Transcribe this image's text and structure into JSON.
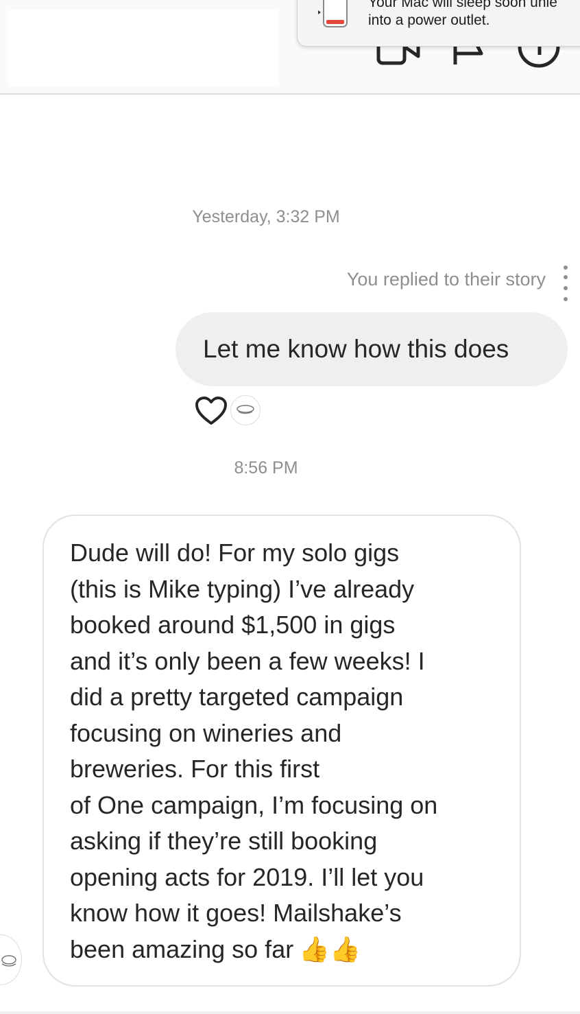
{
  "notification": {
    "line1": "Your Mac will sleep soon unle",
    "line2": "into a power outlet.",
    "icon": "battery-low-icon"
  },
  "header": {
    "icons": [
      "video-call-icon",
      "flag-icon",
      "info-icon"
    ]
  },
  "thread": {
    "timestamp_1": "Yesterday, 3:32 PM",
    "story_reply_label": "You replied to their story",
    "outgoing_message": "Let me know how this does",
    "timestamp_2": "8:56 PM",
    "incoming_lines": [
      "Dude will do! For my solo gigs",
      "(this is Mike typing) I’ve already",
      "booked around $1,500 in gigs",
      "and it’s only been a few weeks! I",
      "did a pretty targeted campaign",
      "focusing on wineries and",
      "breweries. For this first",
      "of One campaign, I’m focusing on",
      "asking if they’re still booking",
      "opening acts for 2019. I’ll let you",
      "know how it goes! Mailshake’s",
      "been amazing so far"
    ],
    "emoji": "👍👍"
  },
  "colors": {
    "timestamp": "#8e8e8e",
    "outgoing_bubble": "#efefef",
    "text": "#262626",
    "battery_low": "#e5483b"
  }
}
